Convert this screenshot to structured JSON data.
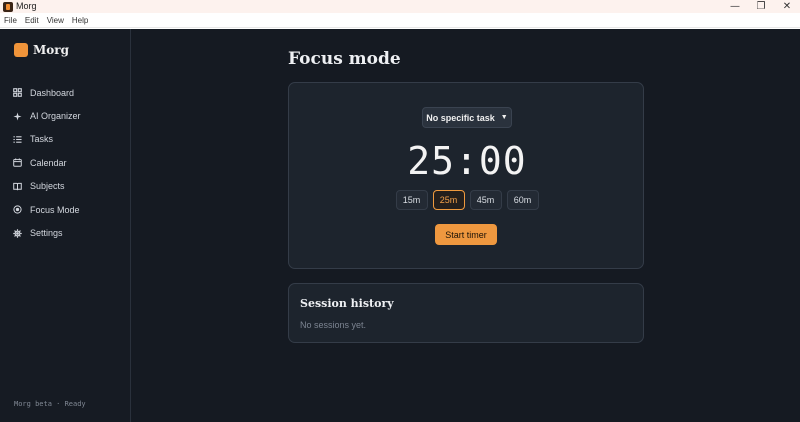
{
  "window": {
    "title": "Morg",
    "controls": {
      "minimize": "—",
      "maximize": "❐",
      "close": "✕"
    }
  },
  "menu": [
    "File",
    "Edit",
    "View",
    "Help"
  ],
  "sidebar": {
    "brand": "Morg",
    "items": [
      {
        "label": "Dashboard",
        "icon": "grid-icon"
      },
      {
        "label": "AI Organizer",
        "icon": "sparkle-icon"
      },
      {
        "label": "Tasks",
        "icon": "list-icon"
      },
      {
        "label": "Calendar",
        "icon": "calendar-icon"
      },
      {
        "label": "Subjects",
        "icon": "book-icon"
      },
      {
        "label": "Focus Mode",
        "icon": "focus-icon"
      },
      {
        "label": "Settings",
        "icon": "gear-icon"
      }
    ],
    "status": "Morg beta · Ready"
  },
  "main": {
    "title": "Focus mode",
    "timer": {
      "task_select": "No specific task",
      "time": "25:00",
      "durations": [
        "15m",
        "25m",
        "45m",
        "60m"
      ],
      "selected_duration": "25m",
      "start_label": "Start timer"
    },
    "history": {
      "title": "Session history",
      "empty": "No sessions yet."
    }
  },
  "colors": {
    "accent": "#ef983f",
    "background": "#151a22",
    "card": "#1d242d"
  }
}
